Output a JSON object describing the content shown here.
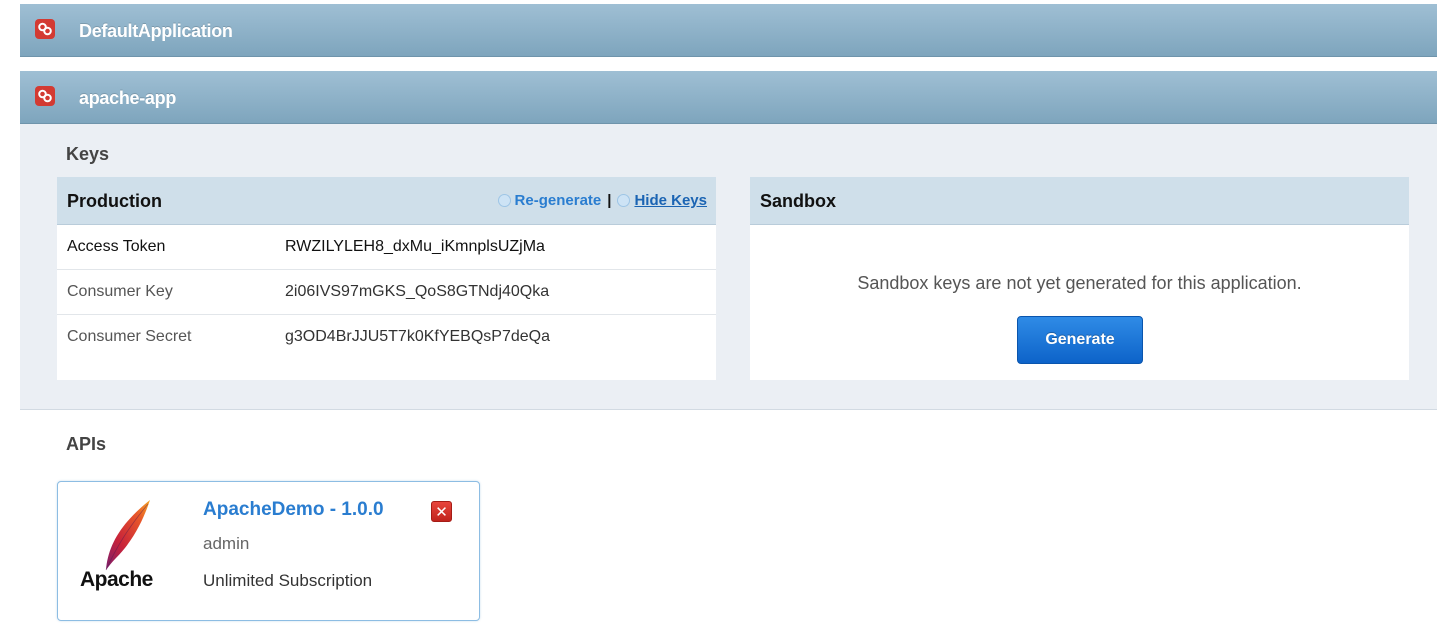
{
  "applications": [
    {
      "name": "DefaultApplication"
    },
    {
      "name": "apache-app"
    }
  ],
  "keys": {
    "title": "Keys",
    "production": {
      "title": "Production",
      "regenerate_label": "Re-generate",
      "separator": "|",
      "hide_keys_label": "Hide Keys",
      "rows": [
        {
          "label": "Access Token",
          "value": "RWZILYLEH8_dxMu_iKmnplsUZjMa"
        },
        {
          "label": "Consumer Key",
          "value": "2i06IVS97mGKS_QoS8GTNdj40Qka"
        },
        {
          "label": "Consumer Secret",
          "value": "g3OD4BrJJU5T7k0KfYEBQsP7deQa"
        }
      ]
    },
    "sandbox": {
      "title": "Sandbox",
      "message": "Sandbox keys are not yet generated for this application.",
      "generate_label": "Generate"
    }
  },
  "apis": {
    "title": "APIs",
    "items": [
      {
        "logo_text": "Apache",
        "name": "ApacheDemo - 1.0.0",
        "owner": "admin",
        "tier": "Unlimited Subscription",
        "delete_icon": "close-icon"
      }
    ]
  },
  "colors": {
    "header_bar": "#8fb3c9",
    "panel_header": "#cfdfea",
    "link_blue": "#2a7dd0",
    "button_blue": "#1a74d8",
    "delete_red": "#d8332b"
  }
}
